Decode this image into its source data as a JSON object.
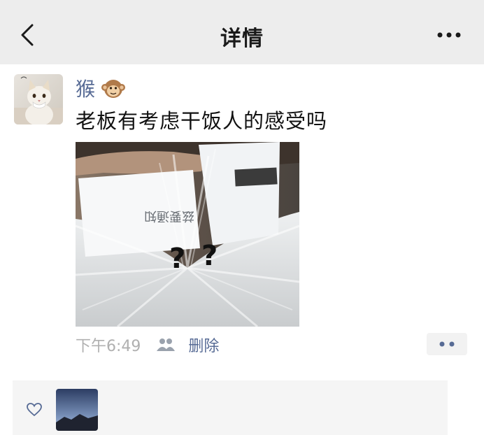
{
  "nav": {
    "title": "详情",
    "back_icon": "chevron-left-icon",
    "more_icon": "ellipsis-icon"
  },
  "post": {
    "username": "猴",
    "username_emoji": "monkey-emoji",
    "text": "老板有考虑干饭人的感受吗",
    "time": "下午6:49",
    "visibility_icon": "people-icon",
    "delete_label": "删除",
    "comment_icon": "two-dots-icon"
  },
  "likes": {
    "icon": "heart-icon"
  },
  "colors": {
    "link": "#576b95",
    "nav_bg": "#ededed",
    "text": "#111111",
    "time": "#b0b0b0"
  }
}
